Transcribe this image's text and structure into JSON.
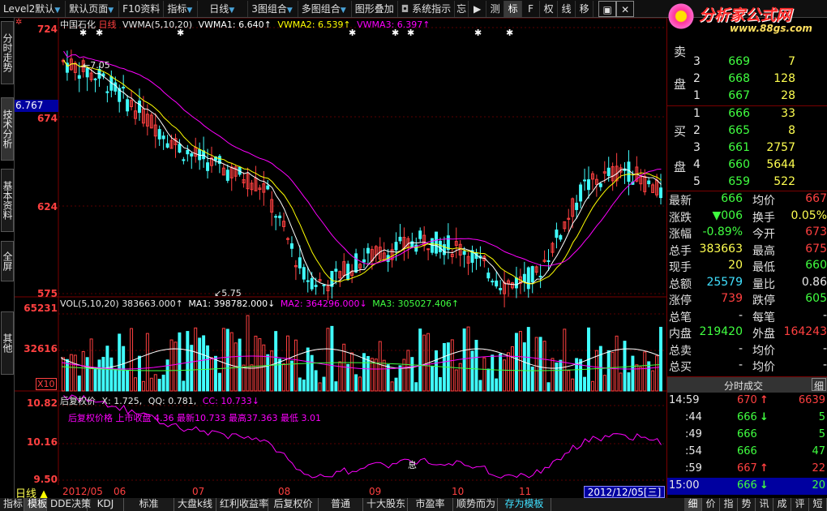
{
  "toolbar": {
    "items": [
      "Level2默认",
      "默认页面",
      "F10资料",
      "指标",
      "日线",
      "3图组合",
      "多图组合",
      "图形叠加",
      "系统指示",
      "忘"
    ],
    "mini_tabs": [
      "测",
      "标",
      "F",
      "权",
      "线",
      "移"
    ],
    "logo_text": "分析家公式网",
    "logo_url": "www.88gs.com"
  },
  "left_tabs": [
    "分时走势",
    "技术分析",
    "基本资料",
    "全屏",
    "其他"
  ],
  "price_panel": {
    "stock_name": "中国石化",
    "period": "日线",
    "indicator": "VWMA(5,10,20)",
    "vwma1": "VWMA1: 6.640↑",
    "vwma2": "VWMA2: 6.539↑",
    "vwma3": "VWMA3: 6.397↑",
    "axis": [
      "724",
      "674",
      "624",
      "575"
    ],
    "current_price": "6.767",
    "high_mark": "7.05",
    "low_mark": "5.75"
  },
  "volume_panel": {
    "title": "VOL(5,10,20)",
    "value": "383663.000↑",
    "ma1": "MA1: 398782.000↓",
    "ma2": "MA2: 364296.000↓",
    "ma3": "MA3: 305027.406↑",
    "axis": [
      "65231",
      "32616"
    ],
    "unit": "X10"
  },
  "adj_panel": {
    "title": "后复权价",
    "x": "X: 1.725,",
    "qq": "QQ: 0.781,",
    "cc": "CC: 10.733↓",
    "info": "后复权价格  上市收盘 4.36 最新10.733 最高37.363 最低 3.01",
    "axis": [
      "10.82",
      "10.16",
      "9.50"
    ],
    "mark": "息"
  },
  "dates": [
    "2012/05",
    "06",
    "07",
    "08",
    "09",
    "10",
    "11"
  ],
  "current_date": "2012/12/05[三]",
  "period_label": "日线",
  "order_book": {
    "sell_label": "卖盘",
    "buy_label": "买盘",
    "sell": [
      {
        "lvl": "3",
        "price": "669",
        "vol": "7"
      },
      {
        "lvl": "2",
        "price": "668",
        "vol": "128"
      },
      {
        "lvl": "1",
        "price": "667",
        "vol": "28"
      }
    ],
    "buy": [
      {
        "lvl": "1",
        "price": "666",
        "vol": "33"
      },
      {
        "lvl": "2",
        "price": "665",
        "vol": "8"
      },
      {
        "lvl": "3",
        "price": "661",
        "vol": "2757"
      },
      {
        "lvl": "4",
        "price": "660",
        "vol": "5644"
      },
      {
        "lvl": "5",
        "price": "659",
        "vol": "522"
      }
    ]
  },
  "quote": [
    {
      "l": "最新",
      "v": "666",
      "vc": "grn",
      "l2": "均价",
      "v2": "667",
      "v2c": "red"
    },
    {
      "l": "涨跌",
      "v": "▼006",
      "vc": "grn",
      "l2": "换手",
      "v2": "0.05%",
      "v2c": "yel"
    },
    {
      "l": "涨幅",
      "v": "-0.89%",
      "vc": "grn",
      "l2": "今开",
      "v2": "673",
      "v2c": "red"
    },
    {
      "l": "总手",
      "v": "383663",
      "vc": "yel",
      "l2": "最高",
      "v2": "675",
      "v2c": "red"
    },
    {
      "l": "现手",
      "v": "20",
      "vc": "yel",
      "l2": "最低",
      "v2": "660",
      "v2c": "grn"
    },
    {
      "l": "总额",
      "v": "25579",
      "vc": "cyan",
      "l2": "量比",
      "v2": "0.86",
      "v2c": "wht"
    },
    {
      "l": "涨停",
      "v": "739",
      "vc": "red",
      "l2": "跌停",
      "v2": "605",
      "v2c": "grn"
    },
    {
      "l": "总笔",
      "v": "-",
      "vc": "wht",
      "l2": "每笔",
      "v2": "-",
      "v2c": "wht"
    },
    {
      "l": "内盘",
      "v": "219420",
      "vc": "grn",
      "l2": "外盘",
      "v2": "164243",
      "v2c": "red"
    },
    {
      "l": "总卖",
      "v": "-",
      "vc": "wht",
      "l2": "均价",
      "v2": "-",
      "v2c": "wht"
    },
    {
      "l": "总买",
      "v": "-",
      "vc": "wht",
      "l2": "均价",
      "v2": "-",
      "v2c": "wht"
    }
  ],
  "tick_header": "分时成交",
  "tick_header_btn": "细",
  "ticks": [
    {
      "t": "14:59",
      "p": "670",
      "a": "↑",
      "ac": "red",
      "v": "6639",
      "vc": "red"
    },
    {
      "t": ":44",
      "p": "666",
      "a": "↓",
      "ac": "grn",
      "v": "5",
      "vc": "grn"
    },
    {
      "t": ":49",
      "p": "666",
      "a": "",
      "ac": "grn",
      "v": "5",
      "vc": "grn"
    },
    {
      "t": ":54",
      "p": "666",
      "a": "",
      "ac": "grn",
      "v": "47",
      "vc": "grn"
    },
    {
      "t": ":59",
      "p": "667",
      "a": "↑",
      "ac": "red",
      "v": "22",
      "vc": "red"
    },
    {
      "t": "15:00",
      "p": "666",
      "a": "↓",
      "ac": "grn",
      "v": "20",
      "vc": "grn"
    }
  ],
  "bottom_tabs": [
    "指标",
    "模板",
    "DDE决策",
    "KDJ",
    "标准",
    "大盘k线",
    "红利收益率",
    "后复权价",
    "普通",
    "十大股东",
    "市盈率",
    "顺势而为",
    "存为模板"
  ],
  "right_bottom_tabs": [
    "细",
    "价",
    "指",
    "势",
    "讯",
    "成",
    "评",
    "短"
  ],
  "colors": {
    "up": "#ff4040",
    "down": "#40ffff",
    "ma1": "#ffffff",
    "ma2": "#ffff00",
    "ma3": "#ff00ff",
    "grid": "#7a0000"
  }
}
